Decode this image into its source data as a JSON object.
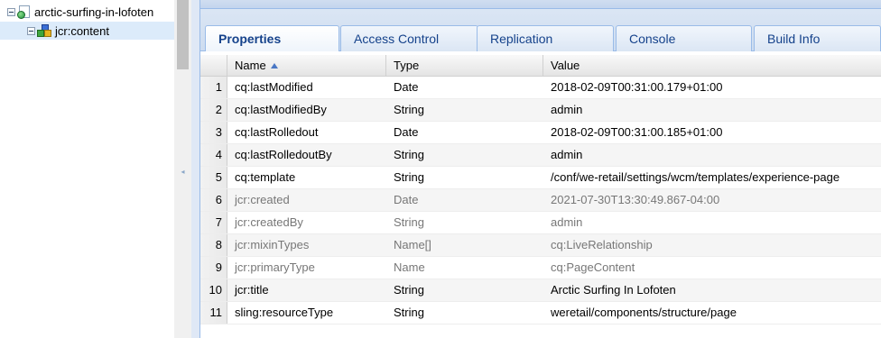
{
  "tree": {
    "root_label": "arctic-surfing-in-lofoten",
    "child_label": "jcr:content"
  },
  "tabs": [
    "Properties",
    "Access Control",
    "Replication",
    "Console",
    "Build Info"
  ],
  "grid": {
    "columns": {
      "name": "Name",
      "type": "Type",
      "value": "Value"
    },
    "rows": [
      {
        "num": "1",
        "name": "cq:lastModified",
        "type": "Date",
        "value": "2018-02-09T00:31:00.179+01:00"
      },
      {
        "num": "2",
        "name": "cq:lastModifiedBy",
        "type": "String",
        "value": "admin"
      },
      {
        "num": "3",
        "name": "cq:lastRolledout",
        "type": "Date",
        "value": "2018-02-09T00:31:00.185+01:00"
      },
      {
        "num": "4",
        "name": "cq:lastRolledoutBy",
        "type": "String",
        "value": "admin"
      },
      {
        "num": "5",
        "name": "cq:template",
        "type": "String",
        "value": "/conf/we-retail/settings/wcm/templates/experience-page"
      },
      {
        "num": "6",
        "name": "jcr:created",
        "type": "Date",
        "value": "2021-07-30T13:30:49.867-04:00"
      },
      {
        "num": "7",
        "name": "jcr:createdBy",
        "type": "String",
        "value": "admin"
      },
      {
        "num": "8",
        "name": "jcr:mixinTypes",
        "type": "Name[]",
        "value": "cq:LiveRelationship"
      },
      {
        "num": "9",
        "name": "jcr:primaryType",
        "type": "Name",
        "value": "cq:PageContent"
      },
      {
        "num": "10",
        "name": "jcr:title",
        "type": "String",
        "value": "Arctic Surfing In Lofoten"
      },
      {
        "num": "11",
        "name": "sling:resourceType",
        "type": "String",
        "value": "weretail/components/structure/page"
      }
    ]
  }
}
